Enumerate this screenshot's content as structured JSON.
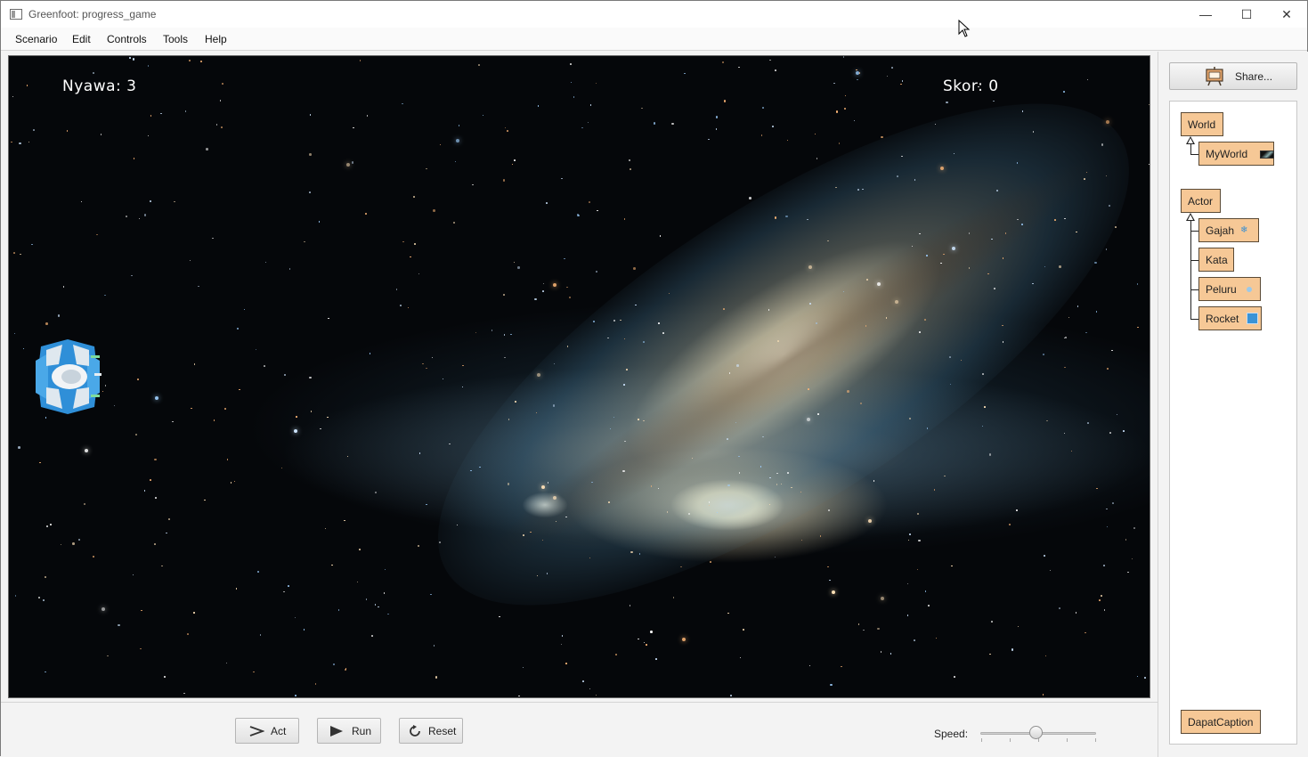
{
  "window": {
    "title": "Greenfoot: progress_game"
  },
  "window_controls": {
    "minimize": "—",
    "maximize": "☐",
    "close": "✕"
  },
  "menu": [
    "Scenario",
    "Edit",
    "Controls",
    "Tools",
    "Help"
  ],
  "world": {
    "lives_text": "Nyawa: 3",
    "score_text": "Skor: 0"
  },
  "controls": {
    "act_label": "Act",
    "run_label": "Run",
    "reset_label": "Reset",
    "speed_label": "Speed:",
    "speed_value": 0.48
  },
  "sidebar": {
    "share_label": "Share...",
    "classes": {
      "world_root": "World",
      "world_subclass": "MyWorld",
      "actor_root": "Actor",
      "actor_subclasses": [
        "Gajah",
        "Kata",
        "Peluru",
        "Rocket"
      ],
      "other": "DapatCaption"
    }
  },
  "colors": {
    "class_box": "#f6c896",
    "space_bg": "#05070a",
    "hud_text": "#ffffff"
  }
}
